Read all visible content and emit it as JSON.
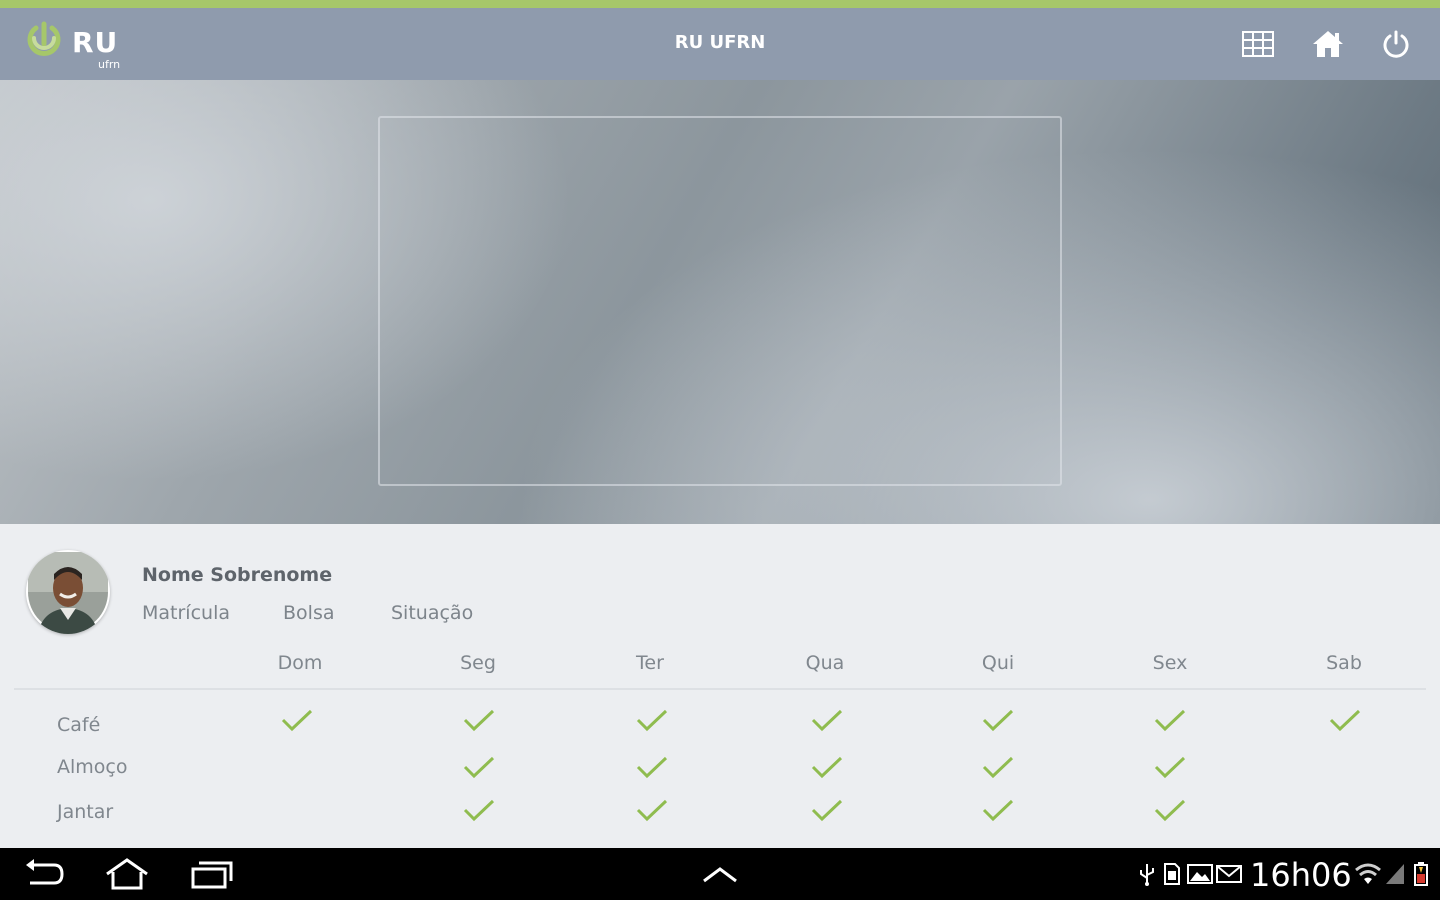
{
  "header": {
    "logo_text": "RU",
    "logo_sub": "ufrn",
    "title": "RU UFRN",
    "buttons": [
      {
        "name": "grid-icon"
      },
      {
        "name": "home-icon"
      },
      {
        "name": "power-icon"
      }
    ]
  },
  "profile": {
    "name": "Nome Sobrenome",
    "matricula_label": "Matrícula",
    "bolsa_label": "Bolsa",
    "situacao_label": "Situação"
  },
  "schedule": {
    "days": [
      "Dom",
      "Seg",
      "Ter",
      "Qua",
      "Qui",
      "Sex",
      "Sab"
    ],
    "meals": [
      {
        "label": "Café",
        "checks": [
          true,
          true,
          true,
          true,
          true,
          true,
          true
        ]
      },
      {
        "label": "Almoço",
        "checks": [
          false,
          true,
          true,
          true,
          true,
          true,
          false
        ]
      },
      {
        "label": "Jantar",
        "checks": [
          false,
          true,
          true,
          true,
          true,
          true,
          false
        ]
      }
    ]
  },
  "status_bar": {
    "time": "16h06",
    "icons": [
      "usb-icon",
      "sd-card-icon",
      "image-icon",
      "mail-icon",
      "wifi-icon",
      "signal-icon",
      "battery-icon"
    ]
  },
  "colors": {
    "accent": "#a6c76a",
    "header": "#8f9bad",
    "check": "#8fbc4f"
  }
}
